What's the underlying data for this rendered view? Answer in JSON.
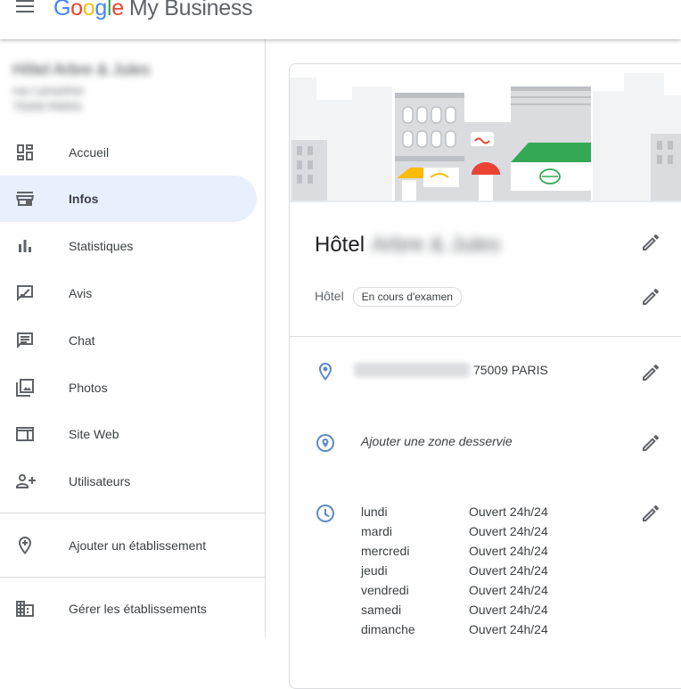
{
  "header": {
    "logo_google_letters": [
      "G",
      "o",
      "o",
      "g",
      "l",
      "e"
    ],
    "product_name": "My Business"
  },
  "sidebar": {
    "business_name": "Hôtel Arbre & Jules",
    "address_line1": "rue Lamartine",
    "address_line2": "75009 PARIS",
    "items": [
      {
        "label": "Accueil",
        "icon": "dashboard-icon",
        "active": false
      },
      {
        "label": "Infos",
        "icon": "store-icon",
        "active": true
      },
      {
        "label": "Statistiques",
        "icon": "bar-chart-icon",
        "active": false
      },
      {
        "label": "Avis",
        "icon": "review-icon",
        "active": false
      },
      {
        "label": "Chat",
        "icon": "chat-icon",
        "active": false
      },
      {
        "label": "Photos",
        "icon": "photo-library-icon",
        "active": false
      },
      {
        "label": "Site Web",
        "icon": "web-icon",
        "active": false
      },
      {
        "label": "Utilisateurs",
        "icon": "person-add-icon",
        "active": false
      }
    ],
    "add_location_label": "Ajouter un établissement",
    "manage_locations_label": "Gérer les établissements"
  },
  "info": {
    "title_prefix": "Hôtel",
    "title_blurred": "Arbre & Jules",
    "category": "Hôtel",
    "status_badge": "En cours d'examen",
    "address_city": "75009 PARIS",
    "service_area_prompt": "Ajouter une zone desservie",
    "hours": [
      {
        "day": "lundi",
        "value": "Ouvert 24h/24"
      },
      {
        "day": "mardi",
        "value": "Ouvert 24h/24"
      },
      {
        "day": "mercredi",
        "value": "Ouvert 24h/24"
      },
      {
        "day": "jeudi",
        "value": "Ouvert 24h/24"
      },
      {
        "day": "vendredi",
        "value": "Ouvert 24h/24"
      },
      {
        "day": "samedi",
        "value": "Ouvert 24h/24"
      },
      {
        "day": "dimanche",
        "value": "Ouvert 24h/24"
      }
    ]
  },
  "colors": {
    "google_blue": "#4285F4",
    "google_red": "#EA4335",
    "google_yellow": "#FBBC05",
    "google_green": "#34A853",
    "active_nav_bg": "#e8f0fe",
    "icon_gray": "#5f6368",
    "divider": "#dadce0"
  }
}
